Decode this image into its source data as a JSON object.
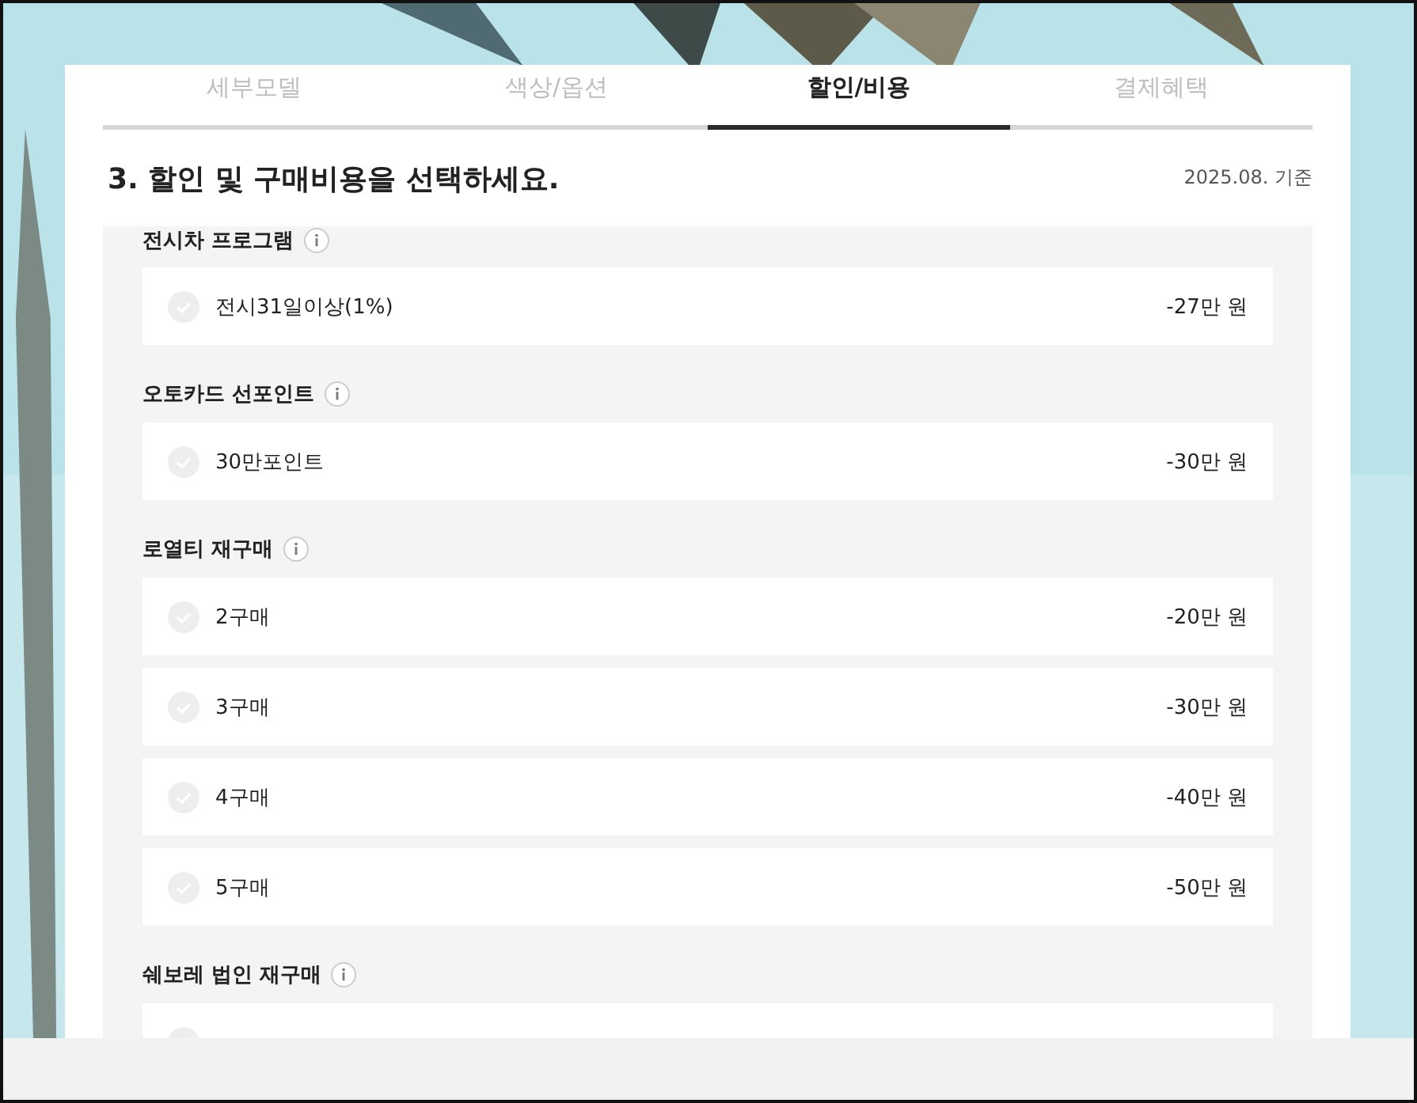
{
  "tabs": [
    {
      "label": "세부모델",
      "selected": false
    },
    {
      "label": "색상/옵션",
      "selected": false
    },
    {
      "label": "할인/비용",
      "selected": true
    },
    {
      "label": "결제혜택",
      "selected": false
    }
  ],
  "heading": "3. 할인 및 구매비용을 선택하세요.",
  "date_note": "2025.08. 기준",
  "sections": [
    {
      "title": "전시차 프로그램",
      "options": [
        {
          "label": "전시31일이상(1%)",
          "amount": "-27만 원",
          "checked": false
        }
      ]
    },
    {
      "title": "오토카드 선포인트",
      "options": [
        {
          "label": "30만포인트",
          "amount": "-30만 원",
          "checked": false
        }
      ]
    },
    {
      "title": "로열티 재구매",
      "options": [
        {
          "label": "2구매",
          "amount": "-20만 원",
          "checked": false
        },
        {
          "label": "3구매",
          "amount": "-30만 원",
          "checked": false
        },
        {
          "label": "4구매",
          "amount": "-40만 원",
          "checked": false
        },
        {
          "label": "5구매",
          "amount": "-50만 원",
          "checked": false
        }
      ]
    },
    {
      "title": "쉐보레 법인 재구매",
      "options": [
        {
          "checked": false
        }
      ]
    }
  ]
}
